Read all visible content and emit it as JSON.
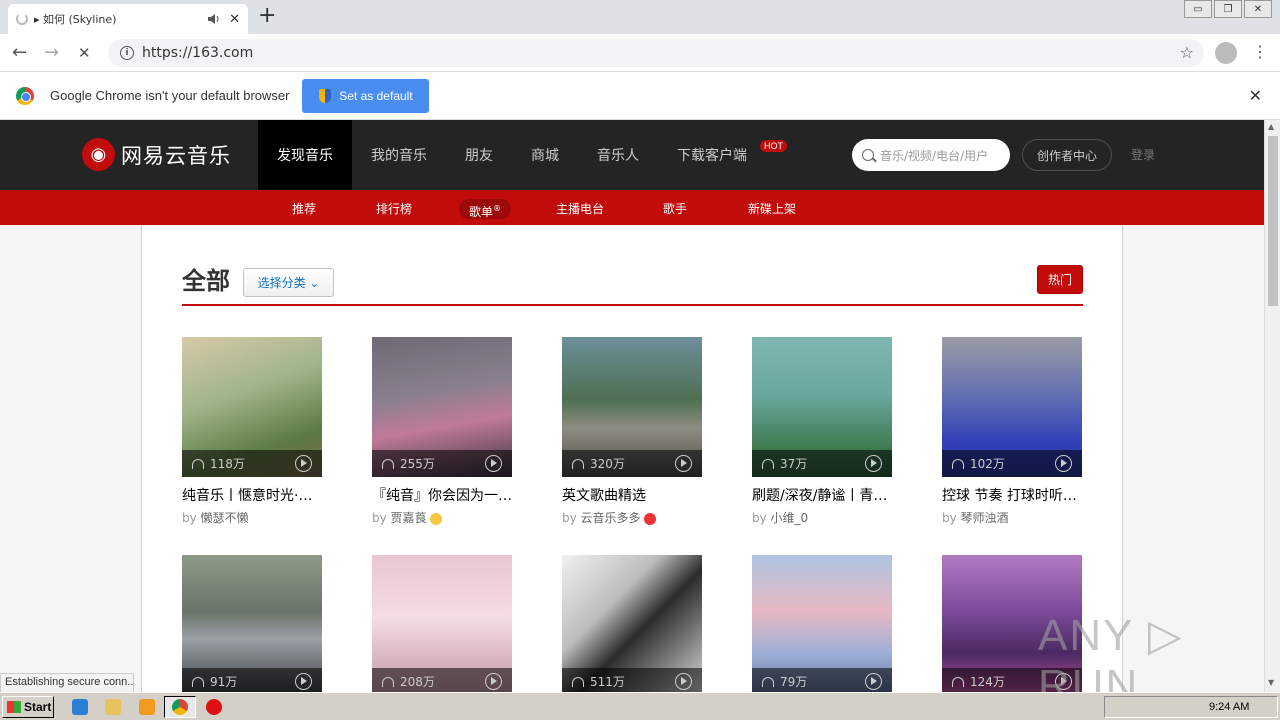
{
  "browser": {
    "tab_title": "▸ 如何 (Skyline)",
    "tab_close": "✕",
    "new_tab": "+",
    "url": "https://163.com",
    "back": "←",
    "forward": "→",
    "reload": "✕",
    "star": "☆",
    "menu": "⋮",
    "window_buttons": [
      "▭",
      "❐",
      "✕"
    ]
  },
  "infobar": {
    "message": "Google Chrome isn't your default browser",
    "button": "Set as default",
    "close": "✕"
  },
  "site": {
    "logo_mark": "◉",
    "brand": "网易云音乐",
    "nav": [
      "发现音乐",
      "我的音乐",
      "朋友",
      "商城",
      "音乐人",
      "下载客户端"
    ],
    "hot": "HOT",
    "search_placeholder": "音乐/视频/电台/用户",
    "creator": "创作者中心",
    "login": "登录",
    "subnav": [
      "推荐",
      "排行榜",
      "歌单",
      "主播电台",
      "歌手",
      "新碟上架"
    ],
    "subnav_mark": "®"
  },
  "page": {
    "heading": "全部",
    "category_button": "选择分类 ⌄",
    "hot_button": "热门",
    "by": "by",
    "playlists": [
      {
        "count": "118万",
        "title": "纯音乐丨惬意时光·…",
        "author": "懒瑟不懒"
      },
      {
        "count": "255万",
        "title": "『纯音』你会因为一…",
        "author": "贾嘉莨"
      },
      {
        "count": "320万",
        "title": "英文歌曲精选",
        "author": "云音乐多多"
      },
      {
        "count": "37万",
        "title": "刷题/深夜/静谧丨青…",
        "author": "小维_0"
      },
      {
        "count": "102万",
        "title": "控球 节奏 打球时听…",
        "author": "琴师浊酒"
      },
      {
        "count": "91万"
      },
      {
        "count": "208万"
      },
      {
        "count": "511万"
      },
      {
        "count": "79万"
      },
      {
        "count": "124万"
      }
    ]
  },
  "status": "Establishing secure conn...",
  "watermark": "ANY ▷ RUN",
  "taskbar": {
    "start": "Start",
    "clock": "9:24 AM"
  },
  "colors": {
    "brand_red": "#c20c0c",
    "topbar": "#242424",
    "chrome_blue": "#4a8df0"
  }
}
